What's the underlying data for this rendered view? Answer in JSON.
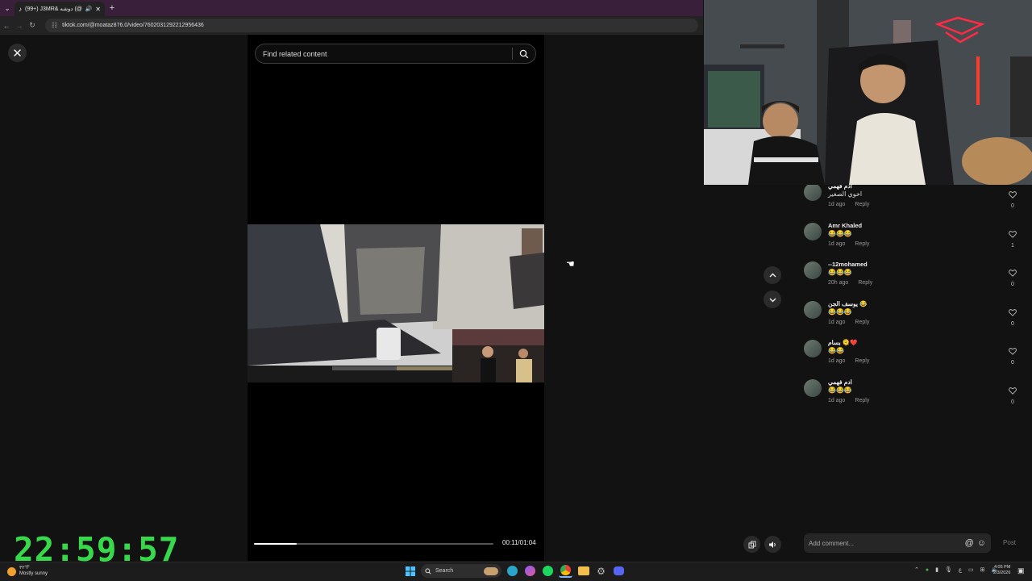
{
  "browser": {
    "tab_title": "(99+) J3MR& دوشه (@moat...",
    "url": "tiktok.com/@moataz876.0/video/7602031292212956436"
  },
  "player": {
    "search_placeholder": "Find related content",
    "progress": 0.18,
    "time": "00:11/01:04"
  },
  "comments": [
    {
      "user": "ادم فهمي",
      "text": "اخوي الصغير",
      "time": "1d ago",
      "reply": "Reply",
      "likes": "0"
    },
    {
      "user": "Amr Khaled",
      "text": "😂😂😂",
      "time": "1d ago",
      "reply": "Reply",
      "likes": "1"
    },
    {
      "user": "--12mohamed",
      "text": "😂😂😂",
      "time": "20h ago",
      "reply": "Reply",
      "likes": "0"
    },
    {
      "user": "يوسف الجن 😂",
      "text": "😂😂😂",
      "time": "1d ago",
      "reply": "Reply",
      "likes": "0"
    },
    {
      "user": "بسام 🫠❤️",
      "text": "😂😂",
      "time": "1d ago",
      "reply": "Reply",
      "likes": "0"
    },
    {
      "user": "ادم فهمي",
      "text": "😂😂😂",
      "time": "1d ago",
      "reply": "Reply",
      "likes": "0"
    }
  ],
  "comment_box": {
    "placeholder": "Add comment...",
    "post": "Post"
  },
  "overlay_clock": "22:59:57",
  "taskbar": {
    "weather_temp": "٣٢°F",
    "weather_desc": "Mostly sunny",
    "search_label": "Search",
    "time": "4:05 PM",
    "date": "2/3/2026"
  },
  "colors": {
    "clock": "#37d94a",
    "tab_strip": "#3a1f3b",
    "background": "#121212"
  }
}
